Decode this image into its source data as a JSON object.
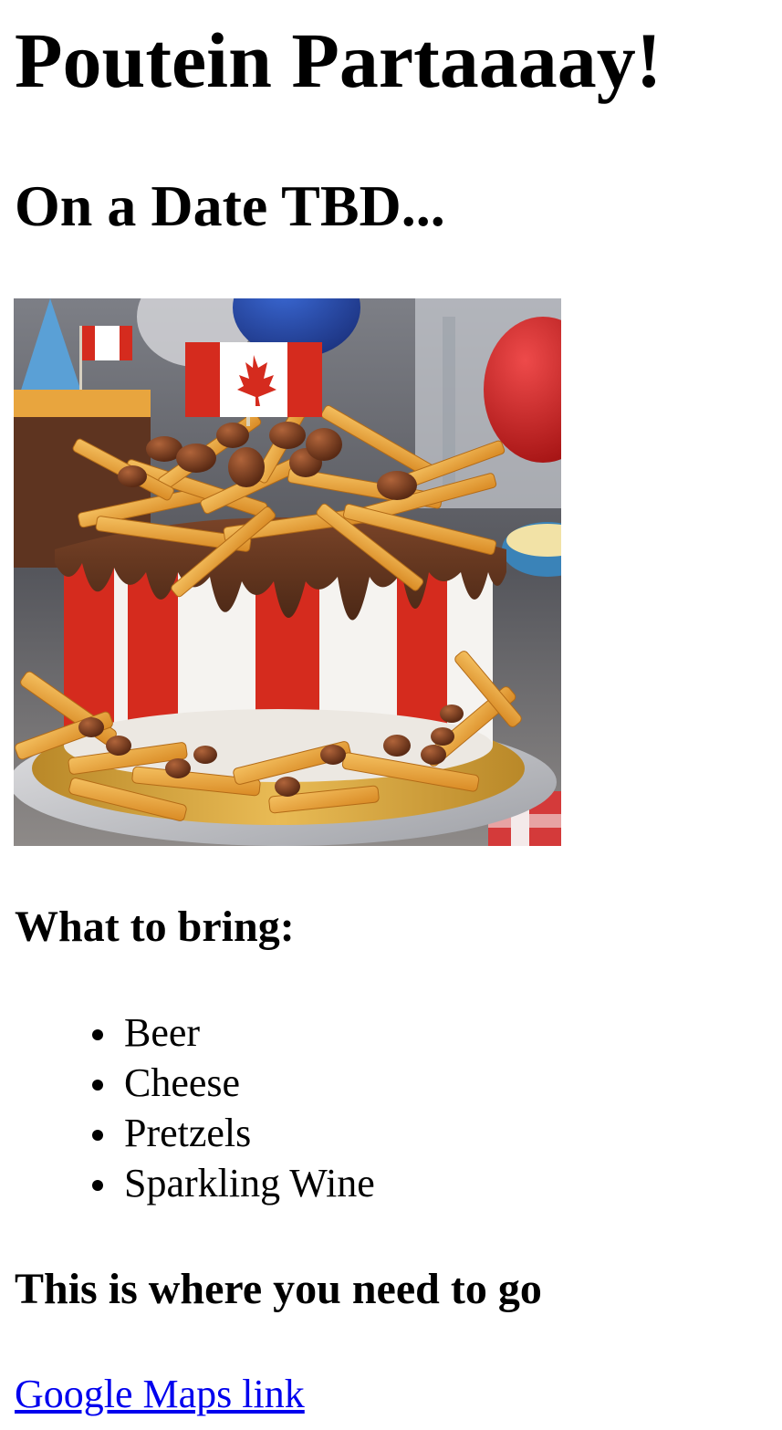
{
  "page": {
    "title": "Poutein Partaaaay!",
    "subtitle": "On a Date TBD..."
  },
  "hero_image": {
    "depicts": "cake-topped-with-poutine-fries-and-canadian-flag",
    "colors": {
      "flag_red": "#d52b1e",
      "chocolate": "#6b3a22",
      "fries": "#e8a53e",
      "board_gold": "#d9a53b"
    }
  },
  "bring": {
    "heading": "What to bring:",
    "items": [
      "Beer",
      "Cheese",
      "Pretzels",
      "Sparkling Wine"
    ]
  },
  "location": {
    "heading": "This is where you need to go",
    "link_text": "Google Maps link",
    "link_color": "#0000ee"
  }
}
